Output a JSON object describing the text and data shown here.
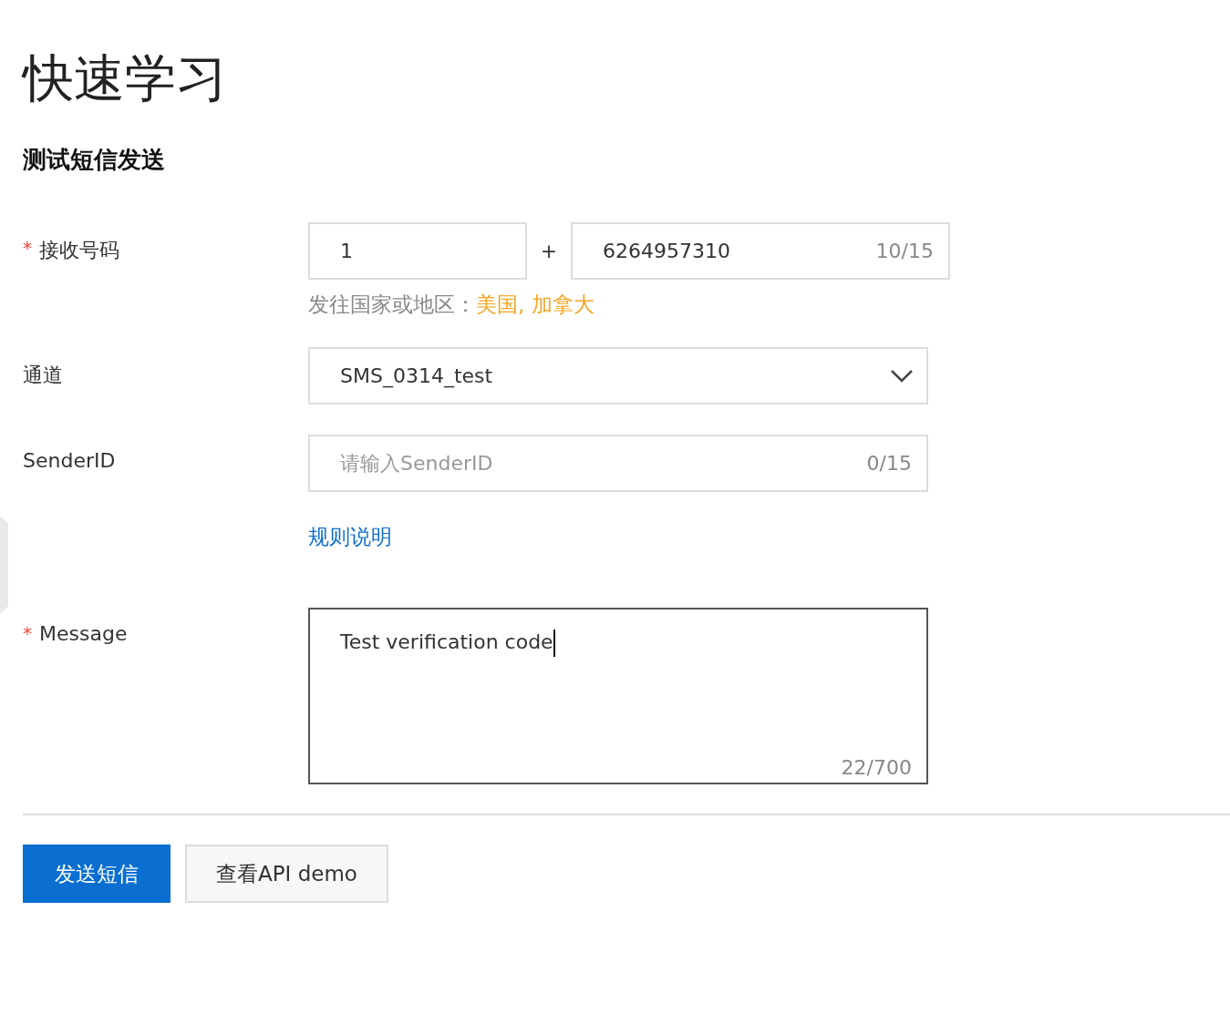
{
  "page": {
    "title": "快速学习"
  },
  "section": {
    "title": "测试短信发送"
  },
  "phone": {
    "label": "接收号码",
    "required_mark": "*",
    "country_code": "1",
    "separator": "+",
    "number": "6264957310",
    "counter": "10/15",
    "hint_prefix": "发往国家或地区：",
    "hint_regions": "美国, 加拿大"
  },
  "channel": {
    "label": "通道",
    "value": "SMS_0314_test"
  },
  "sender": {
    "label": "SenderID",
    "placeholder": "请输入SenderID",
    "counter": "0/15",
    "link": "规则说明"
  },
  "message": {
    "label": "Message",
    "required_mark": "*",
    "value": "Test verification code",
    "counter": "22/700",
    "focused": true
  },
  "buttons": [
    {
      "label": "发送短信",
      "kind": "primary"
    },
    {
      "label": "查看API demo",
      "kind": "secondary"
    }
  ]
}
